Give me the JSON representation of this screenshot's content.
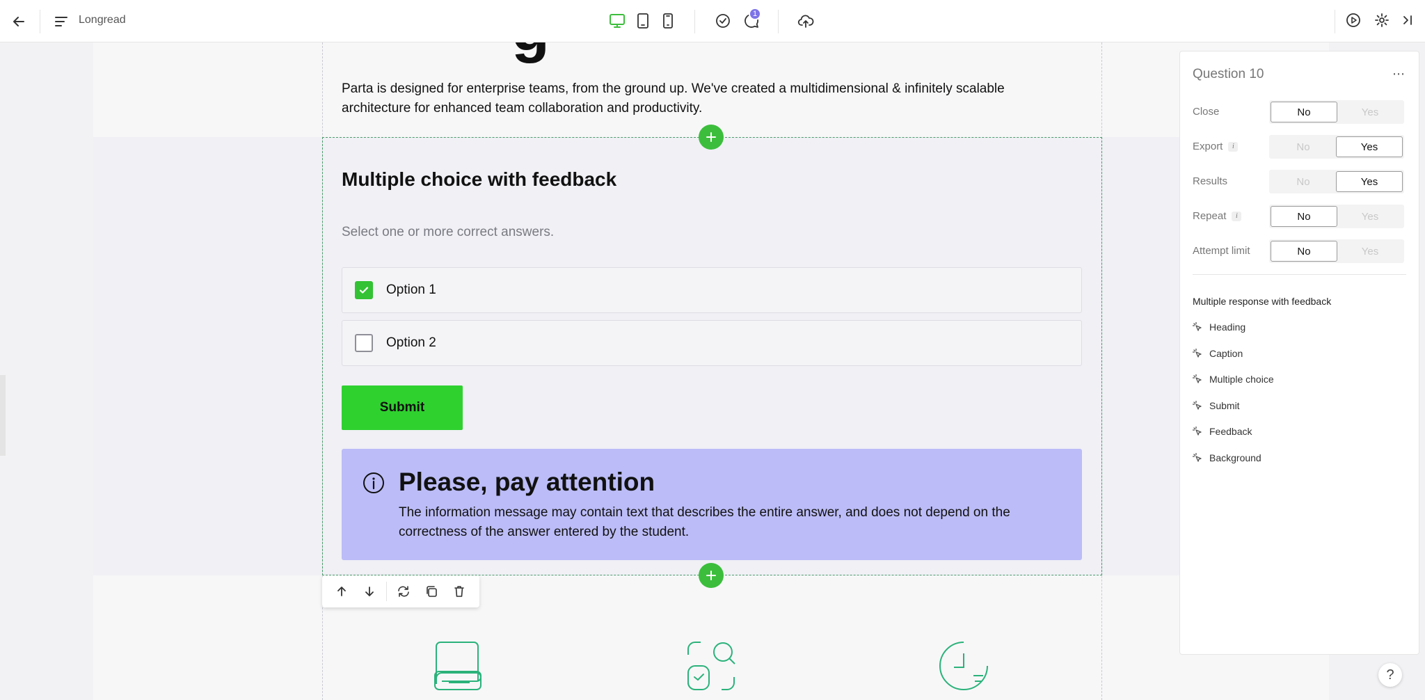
{
  "app": {
    "title": "Longread",
    "notification_count": "1"
  },
  "content": {
    "intro_text": "Parta is designed for enterprise teams, from the ground up. We've created a multidimensional & infinitely scalable architecture for enhanced team collaboration and productivity.",
    "heading_fragment": "g",
    "question": {
      "title": "Multiple choice with feedback",
      "caption": "Select one or more correct answers.",
      "options": [
        {
          "label": "Option 1",
          "checked": true
        },
        {
          "label": "Option 2",
          "checked": false
        }
      ],
      "submit_label": "Submit"
    },
    "feedback": {
      "title": "Please, pay attention",
      "text": "The information message may contain text that describes the entire answer, and does not depend on the correctness of the answer entered by the student."
    }
  },
  "panel": {
    "title": "Question 10",
    "settings": [
      {
        "label": "Close",
        "info": false,
        "no": "No",
        "yes": "Yes",
        "value": "No"
      },
      {
        "label": "Export",
        "info": true,
        "no": "No",
        "yes": "Yes",
        "value": "Yes"
      },
      {
        "label": "Results",
        "info": false,
        "no": "No",
        "yes": "Yes",
        "value": "Yes"
      },
      {
        "label": "Repeat",
        "info": true,
        "no": "No",
        "yes": "Yes",
        "value": "No"
      },
      {
        "label": "Attempt limit",
        "info": false,
        "no": "No",
        "yes": "Yes",
        "value": "No"
      }
    ],
    "section_title": "Multiple response with feedback",
    "layers": [
      "Heading",
      "Caption",
      "Multiple choice",
      "Submit",
      "Feedback",
      "Background"
    ]
  },
  "help_label": "?",
  "colors": {
    "accent_green": "#3cbe3c",
    "submit_green": "#2fd12f",
    "feedback_bg": "#bcbcf8",
    "icon_teal": "#2bb27a",
    "badge": "#7d74e8"
  }
}
